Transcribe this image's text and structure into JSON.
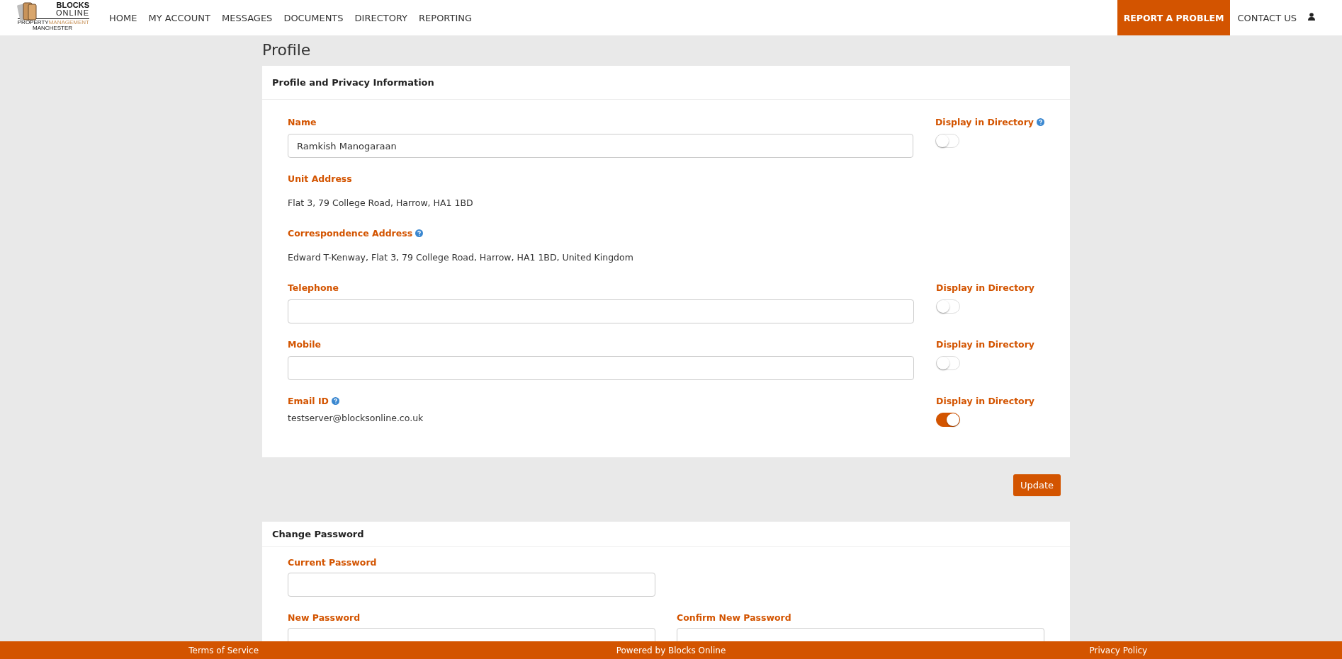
{
  "header": {
    "logo": {
      "line1": "BLOCKS",
      "line2": "ONLINE",
      "line3a": "PROPERTY",
      "line3b": "MANAGEMENT",
      "line4": "MANCHESTER"
    },
    "nav": [
      "HOME",
      "MY ACCOUNT",
      "MESSAGES",
      "DOCUMENTS",
      "DIRECTORY",
      "REPORTING"
    ],
    "report_button": "REPORT A PROBLEM",
    "contact_link": "CONTACT US"
  },
  "page_title": "Profile",
  "profile_card": {
    "title": "Profile and Privacy Information",
    "fields": [
      {
        "label": "Name",
        "help": false,
        "kind": "input",
        "value": "Ramkish Manogaraan",
        "directory": {
          "label": "Display in Directory",
          "help": true,
          "on": false
        }
      },
      {
        "label": "Unit Address",
        "help": false,
        "kind": "text",
        "value": "Flat 3, 79 College Road, Harrow, HA1 1BD"
      },
      {
        "label": "Correspondence Address",
        "help": true,
        "kind": "text",
        "value": "Edward T-Kenway, Flat 3, 79 College Road, Harrow, HA1 1BD, United Kingdom"
      },
      {
        "label": "Telephone",
        "help": false,
        "kind": "input",
        "directory": {
          "label": "Display in Directory",
          "help": false,
          "on": false
        }
      },
      {
        "label": "Mobile",
        "help": false,
        "kind": "input",
        "directory": {
          "label": "Display in Directory",
          "help": false,
          "on": false
        }
      },
      {
        "label": "Email ID",
        "help": true,
        "kind": "text",
        "value": "testserver@blocksonline.co.uk",
        "directory": {
          "label": "Display in Directory",
          "help": false,
          "on": true
        }
      }
    ]
  },
  "update_button": "Update",
  "password_card": {
    "title": "Change Password",
    "current": {
      "label": "Current Password"
    },
    "new": {
      "label": "New Password"
    },
    "confirm": {
      "label": "Confirm New Password"
    }
  },
  "footer": [
    "Terms of Service",
    "Powered by Blocks Online",
    "Privacy Policy"
  ]
}
